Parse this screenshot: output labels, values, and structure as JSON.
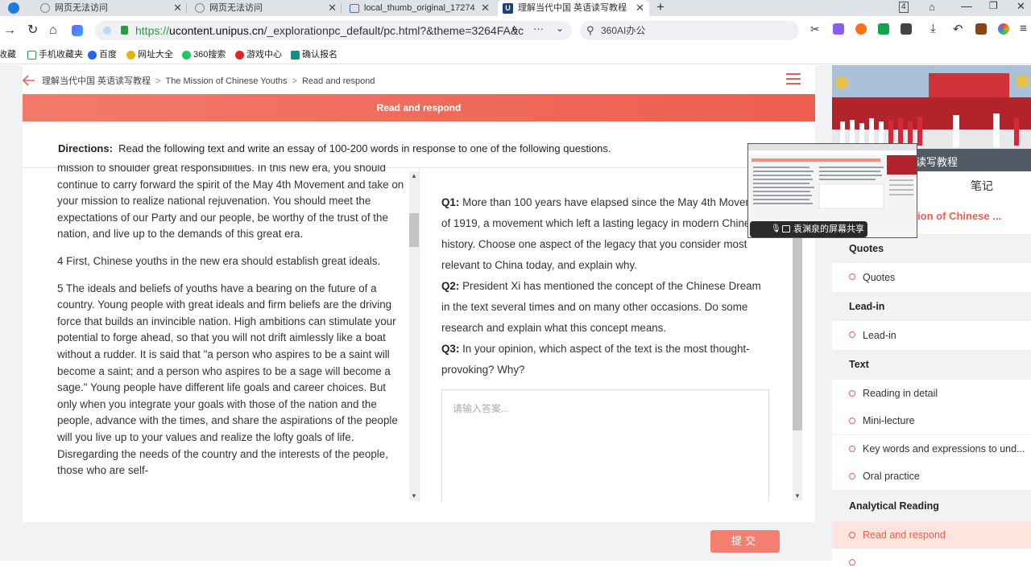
{
  "browser": {
    "tabs": [
      {
        "label": "网页无法访问"
      },
      {
        "label": "网页无法访问"
      },
      {
        "label": "local_thumb_original_17274"
      },
      {
        "label": "理解当代中国 英语读写教程"
      }
    ],
    "url_https": "https://",
    "url_host": "ucontent.unipus.cn",
    "url_rest": "/_explorationpc_default/pc.html?&theme=3264FA&c",
    "search_text": "360AI办公",
    "bookmarks": [
      "收藏",
      "手机收藏夹",
      "百度",
      "网址大全",
      "360搜索",
      "游戏中心",
      "确认报名"
    ]
  },
  "breadcrumb": {
    "course": "理解当代中国 英语读写教程",
    "unit": "The Mission of Chinese Youths",
    "page": "Read and respond"
  },
  "banner_title": "Read and respond",
  "directions": {
    "label": "Directions:",
    "text": "Read the following text and write an essay of 100-200 words in response to one of the following questions."
  },
  "reading": {
    "p0": "mission to shoulder great responsibilities. In this new era, you should continue to carry forward the spirit of the May 4th Movement and take on your mission to realize national rejuvenation. You should meet the expectations of our Party and our people, be worthy of the trust of the nation, and live up to the demands of this great era.",
    "p1": "4 First, Chinese youths in the new era should establish great ideals.",
    "p2": "5 The ideals and beliefs of youths have a bearing on the future of a country. Young people with great ideals and firm beliefs are the driving force that builds an invincible nation. High ambitions can stimulate your potential to forge ahead, so that you will not drift aimlessly like a boat without a rudder. It is said that \"a person who aspires to be a saint will become a saint; and a person who aspires to be a sage will become a sage.\" Young people have different life goals and career choices. But only when you integrate your goals with those of the nation and the people, advance with the times, and share the aspirations of the people will you live up to your values and realize the lofty goals of life. Disregarding the needs of the country and the interests of the people, those who are self-"
  },
  "questions": [
    {
      "label": "Q1:",
      "text": "More than 100 years have elapsed since the May 4th Movement of 1919, a movement which left a lasting legacy in modern Chinese history. Choose one aspect of the legacy that you consider most relevant to China today, and explain why."
    },
    {
      "label": "Q2:",
      "text": "President Xi has mentioned the concept of the Chinese Dream in the text several times and on many other occasions. Do some research and explain what this concept means."
    },
    {
      "label": "Q3:",
      "text": "In your opinion, which aspect of the text is the most thought-provoking? Why?"
    }
  ],
  "answer_placeholder": "请输入答案...",
  "submit_label": "提交",
  "sidebar": {
    "image_caption": "读写教程",
    "notes_tab": "笔记",
    "unit_title": "ission of Chinese ...",
    "sections": [
      {
        "title": "Quotes",
        "items": [
          {
            "label": "Quotes",
            "active": false
          }
        ]
      },
      {
        "title": "Lead-in",
        "items": [
          {
            "label": "Lead-in",
            "active": false
          }
        ]
      },
      {
        "title": "Text",
        "items": [
          {
            "label": "Reading in detail",
            "active": false
          },
          {
            "label": "Mini-lecture",
            "active": false
          },
          {
            "label": "Key words and expressions to und...",
            "active": false
          },
          {
            "label": "Oral practice",
            "active": false
          }
        ]
      },
      {
        "title": "Analytical Reading",
        "items": [
          {
            "label": "Read and respond",
            "active": true
          }
        ]
      }
    ]
  },
  "screen_share": {
    "label": "袁渊泉的屏幕共享"
  },
  "colors": {
    "accent": "#e8604c",
    "banner_start": "#f37a6a",
    "banner_end": "#ee5d4d",
    "active_item_bg": "#fde4df",
    "url_secure": "#2e9a3f"
  }
}
